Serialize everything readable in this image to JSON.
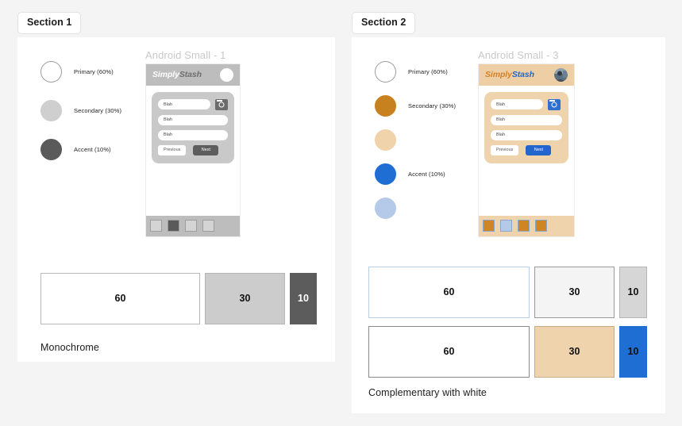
{
  "canvas": {
    "background": "#f4f4f4"
  },
  "sections": [
    {
      "tab_label": "Section 1",
      "panel_background": "#ffffff",
      "swatches": [
        {
          "label": "Primary (60%)",
          "color": "#ffffff",
          "border": "#9b9b9b"
        },
        {
          "label": "Secondary (30%)",
          "color": "#cfcfcf",
          "border": "#cfcfcf"
        },
        {
          "label": "Accent (10%)",
          "color": "#5a5a5a",
          "border": "#5a5a5a"
        }
      ],
      "phone": {
        "caption": "Android Small - 1",
        "header_bg": "#bdbdbd",
        "brand_first": "Simply",
        "brand_second": "Stash",
        "brand_first_color": "#ffffff",
        "brand_second_color": "#6e6e6e",
        "avatar_color": "#ffffff",
        "avatar_type": "plain-circle",
        "card_bg": "#c9c9c9",
        "fields": [
          "Blah",
          "Blah",
          "Blah"
        ],
        "camera_icon_bg": "#6b6b6b",
        "previous_label": "Previous",
        "next_label": "Next",
        "next_bg": "#5e5e5e",
        "nav_bg": "#bdbdbd",
        "nav_cells": [
          "#d4d4d4",
          "#5a5a5a",
          "#d4d4d4",
          "#d4d4d4"
        ],
        "nav_cell_border": "#9e9e9e"
      },
      "ratios": [
        {
          "cells": [
            {
              "value": "60",
              "fill": "#ffffff",
              "border": "#b9b9b9",
              "text": "#111111"
            },
            {
              "value": "30",
              "fill": "#cccccc",
              "border": "#b5b5b5",
              "text": "#111111"
            },
            {
              "value": "10",
              "fill": "#5c5c5c",
              "border": "#5c5c5c",
              "text": "#ffffff"
            }
          ]
        }
      ],
      "ratio_caption": "Monochrome"
    },
    {
      "tab_label": "Section 2",
      "panel_background": "#ffffff",
      "swatches": [
        {
          "label": "Primary (60%)",
          "color": "#ffffff",
          "border": "#9b9b9b"
        },
        {
          "label": "Secondary (30%)",
          "color": "#c8811f",
          "border": "#c8811f"
        },
        {
          "label": "",
          "color": "#f0d3ab",
          "border": "#f0d3ab"
        },
        {
          "label": "Accent (10%)",
          "color": "#1f6ed4",
          "border": "#1f6ed4"
        },
        {
          "label": "",
          "color": "#b4cae8",
          "border": "#b4cae8"
        }
      ],
      "phone": {
        "caption": "Android Small - 3",
        "header_bg": "#eecfa5",
        "brand_first": "Simply",
        "brand_second": "Stash",
        "brand_first_color": "#d4802a",
        "brand_second_color": "#2266cc",
        "avatar_color": "#4a6173",
        "avatar_type": "photo-circle",
        "card_bg": "#efd3ac",
        "fields": [
          "Blah",
          "Blah",
          "Blah"
        ],
        "camera_icon_bg": "#2f6fd0",
        "previous_label": "Previous",
        "next_label": "Next",
        "next_bg": "#2266cc",
        "nav_bg": "#efd3ac",
        "nav_cells": [
          "#cf8622",
          "#b4cae8",
          "#cf8622",
          "#cf8622"
        ],
        "nav_cell_border": "#8aa7cc"
      },
      "ratios": [
        {
          "cells": [
            {
              "value": "60",
              "fill": "#ffffff",
              "border": "#b8cfe8",
              "text": "#111111"
            },
            {
              "value": "30",
              "fill": "#f4f4f4",
              "border": "#9a9a9a",
              "text": "#111111"
            },
            {
              "value": "10",
              "fill": "#d6d6d6",
              "border": "#b5b5b5",
              "text": "#111111"
            }
          ]
        },
        {
          "cells": [
            {
              "value": "60",
              "fill": "#ffffff",
              "border": "#8a8a8a",
              "text": "#111111"
            },
            {
              "value": "30",
              "fill": "#efd3ac",
              "border": "#c7ab86",
              "text": "#111111"
            },
            {
              "value": "10",
              "fill": "#1f6ed4",
              "border": "#1f6ed4",
              "text": "#111111"
            }
          ]
        }
      ],
      "ratio_caption": "Complementary with white"
    }
  ]
}
